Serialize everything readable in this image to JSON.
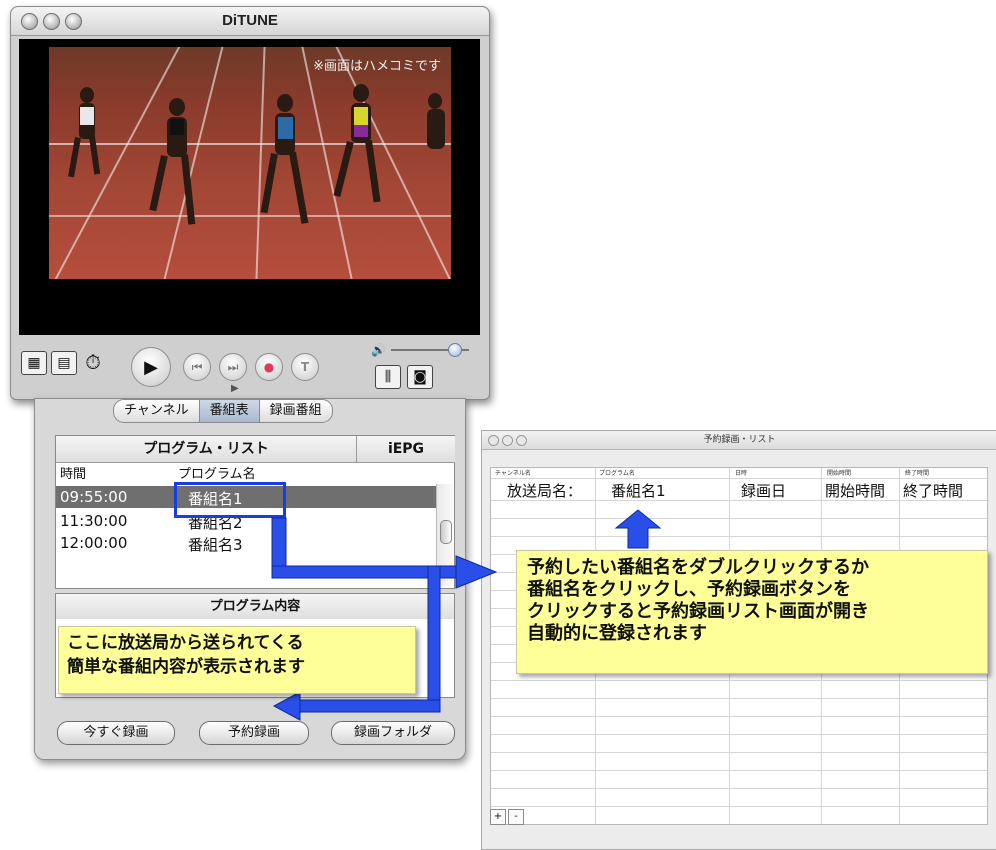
{
  "player": {
    "title": "DiTUNE",
    "overlay_note": "※画面はハメコミです",
    "volume_level": 0.75
  },
  "panel": {
    "tabs": [
      {
        "label": "チャンネル",
        "selected": false
      },
      {
        "label": "番組表",
        "selected": true
      },
      {
        "label": "録画番組",
        "selected": false
      }
    ],
    "list_title": "プログラム・リスト",
    "iepg_label": "iEPG",
    "columns": [
      "時間",
      "プログラム名"
    ],
    "rows": [
      {
        "time": "09:55:00",
        "name": "番組名1",
        "selected": true
      },
      {
        "time": "11:30:00",
        "name": "番組名2",
        "selected": false
      },
      {
        "time": "12:00:00",
        "name": "番組名3",
        "selected": false
      }
    ],
    "desc_title": "プログラム内容",
    "buttons": {
      "record_now": "今すぐ録画",
      "reserve": "予約録画",
      "folder": "録画フォルダ"
    }
  },
  "reservation_window": {
    "title": "予約録画・リスト",
    "columns": [
      "チャンネル名",
      "プログラム名",
      "日時",
      "開始時間",
      "終了時間"
    ],
    "row": [
      "放送局名：",
      "番組名1",
      "録画日",
      "開始時間",
      "終了時間"
    ],
    "add_label": "+",
    "remove_label": "-"
  },
  "callouts": {
    "desc_note": [
      "ここに放送局から送られてくる",
      "簡単な番組内容が表示されます"
    ],
    "reserve_note": [
      "予約したい番組名をダブルクリックするか",
      "番組名をクリックし、予約録画ボタンを",
      "クリックすると予約録画リスト画面が開き",
      "自動的に登録されます"
    ]
  },
  "colors": {
    "highlight_box": "#1a3de0",
    "arrow": "#2a4ee8",
    "callout_bg": "#ffff99"
  }
}
